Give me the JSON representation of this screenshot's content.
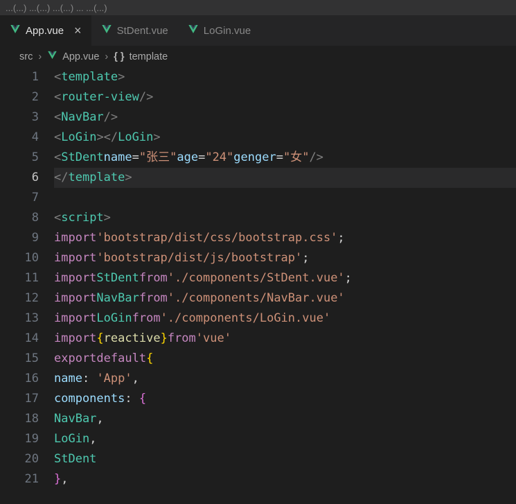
{
  "menubar": "...(...)   ...(...)   ...(...)   ...   ...(...)",
  "tabs": [
    {
      "label": "App.vue",
      "active": true,
      "dirty": false
    },
    {
      "label": "StDent.vue",
      "active": false
    },
    {
      "label": "LoGin.vue",
      "active": false
    }
  ],
  "breadcrumb": {
    "folder": "src",
    "file": "App.vue",
    "symbol": "template"
  },
  "code": {
    "current_line": 6,
    "lines": [
      {
        "n": 1,
        "html": "<span class='p'>&lt;</span><span class='tg'>template</span><span class='p'>&gt;</span>"
      },
      {
        "n": 2,
        "indent": 1,
        "html": "<span class='p'>&lt;</span><span class='tg'>router-view</span> <span class='p'>/&gt;</span>"
      },
      {
        "n": 3,
        "indent": 1,
        "html": "<span class='p'>&lt;</span><span class='tg'>NavBar</span> <span class='p'>/&gt;</span>"
      },
      {
        "n": 4,
        "indent": 1,
        "html": "<span class='p'>&lt;</span><span class='tg'>LoGin</span><span class='p'>&gt;&lt;/</span><span class='tg'>LoGin</span><span class='p'>&gt;</span>"
      },
      {
        "n": 5,
        "indent": 1,
        "html": "<span class='p'>&lt;</span><span class='tg'>StDent</span> <span class='at'>name</span><span class='eq'>=</span><span class='st'>\"张三\"</span> <span class='at'>age</span><span class='eq'>=</span><span class='st'>\"24\"</span> <span class='at'>genger</span><span class='eq'>=</span><span class='st'>\"女\"</span> <span class='p'>/&gt;</span>"
      },
      {
        "n": 6,
        "html": "<span class='p'>&lt;/</span><span class='tg'>template</span><span class='p'>&gt;</span>"
      },
      {
        "n": 7,
        "html": ""
      },
      {
        "n": 8,
        "html": "<span class='p'>&lt;</span><span class='tg'>script</span><span class='p'>&gt;</span>"
      },
      {
        "n": 9,
        "html": "<span class='kw'>import</span> <span class='st'>'bootstrap/dist/css/bootstrap.css'</span><span class='w'>;</span>"
      },
      {
        "n": 10,
        "html": "<span class='kw'>import</span> <span class='st'>'bootstrap/dist/js/bootstrap'</span><span class='w'>;</span>"
      },
      {
        "n": 11,
        "html": "<span class='kw'>import</span> <span class='imp'>StDent</span> <span class='kw'>from</span> <span class='st'>'./components/StDent.vue'</span><span class='w'>;</span>"
      },
      {
        "n": 12,
        "html": "<span class='kw'>import</span> <span class='imp'>NavBar</span> <span class='kw'>from</span> <span class='st'>'./components/NavBar.vue'</span>"
      },
      {
        "n": 13,
        "html": "<span class='kw'>import</span> <span class='imp'>LoGin</span> <span class='kw'>from</span> <span class='st'>'./components/LoGin.vue'</span>"
      },
      {
        "n": 14,
        "html": "<span class='kw'>import</span> <span class='br'>{</span> <span class='fn'>reactive</span> <span class='br'>}</span> <span class='kw'>from</span> <span class='st'>'vue'</span>"
      },
      {
        "n": 15,
        "html": "<span class='kw'>export</span> <span class='kw'>default</span> <span class='br'>{</span>"
      },
      {
        "n": 16,
        "indent": 1,
        "html": "<span class='id'>name</span><span class='w'>: </span><span class='st'>'App'</span><span class='w'>,</span>"
      },
      {
        "n": 17,
        "indent": 1,
        "html": "<span class='id'>components</span><span class='w'>: </span><span class='brp'>{</span>"
      },
      {
        "n": 18,
        "indent": 2,
        "html": "<span class='imp'>NavBar</span><span class='w'>,</span>"
      },
      {
        "n": 19,
        "indent": 2,
        "html": "<span class='imp'>LoGin</span><span class='w'>,</span>"
      },
      {
        "n": 20,
        "indent": 2,
        "html": "<span class='imp'>StDent</span>"
      },
      {
        "n": 21,
        "indent": 1,
        "html": "<span class='brp'>}</span><span class='w'>,</span>"
      }
    ]
  }
}
